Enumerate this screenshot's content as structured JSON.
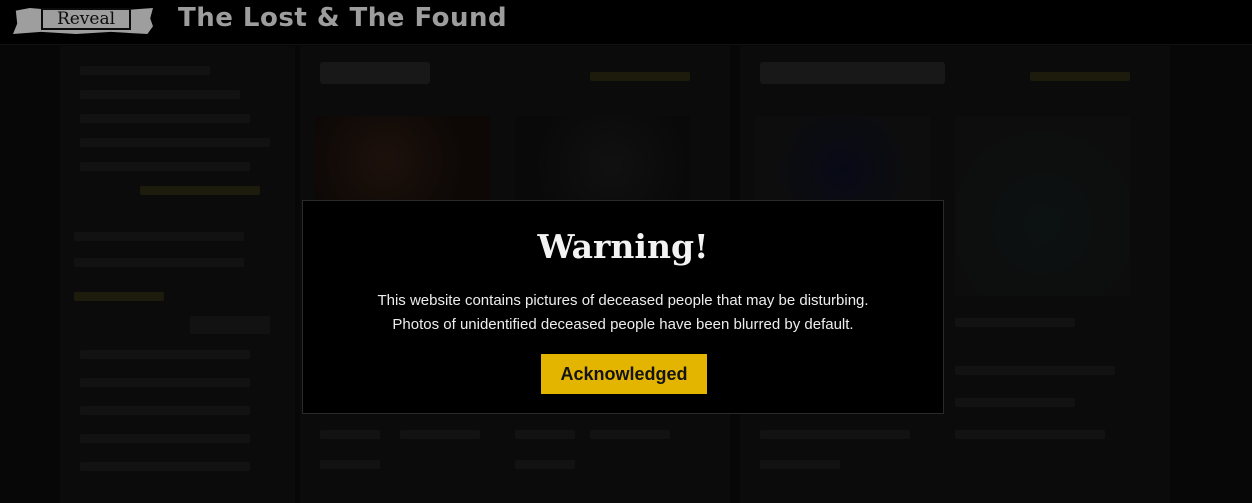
{
  "header": {
    "logo_text": "Reveal",
    "site_title": "The Lost & The Found"
  },
  "modal": {
    "title": "Warning!",
    "message_line1": "This website contains pictures of deceased people that may be disturbing.",
    "message_line2": "Photos of unidentified deceased people have been blurred by default.",
    "button_label": "Acknowledged"
  },
  "colors": {
    "accent": "#e3b500",
    "background": "#000000"
  }
}
